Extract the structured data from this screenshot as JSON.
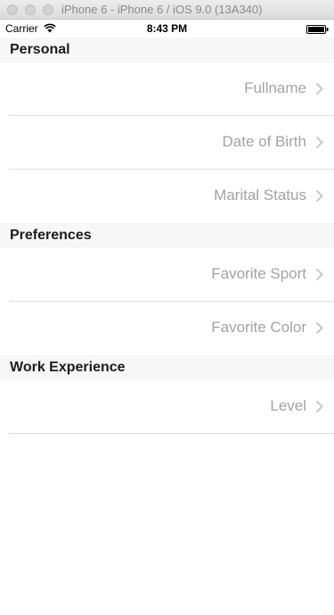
{
  "simulator": {
    "title": "iPhone 6 - iPhone 6 / iOS 9.0 (13A340)"
  },
  "statusbar": {
    "carrier": "Carrier",
    "time": "8:43 PM"
  },
  "sections": [
    {
      "title": "Personal",
      "rows": [
        "Fullname",
        "Date of Birth",
        "Marital Status"
      ]
    },
    {
      "title": "Preferences",
      "rows": [
        "Favorite Sport",
        "Favorite Color"
      ]
    },
    {
      "title": "Work Experience",
      "rows": [
        "Level"
      ]
    }
  ],
  "colors": {
    "section_bg": "#f7f7f7",
    "row_text": "#a3a3a3",
    "separator": "#dcdcdc",
    "chevron": "#c7c7cc"
  }
}
